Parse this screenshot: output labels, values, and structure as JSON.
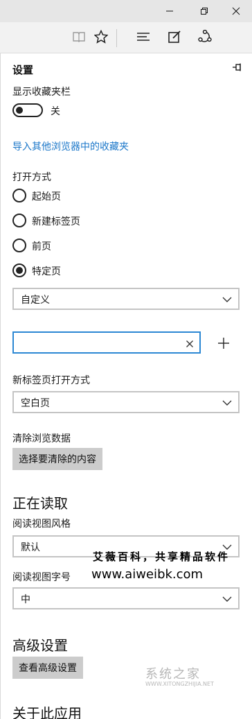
{
  "window_controls": {
    "minimize_icon": "minimize-icon",
    "maximize_icon": "restore-icon",
    "close_icon": "close-icon"
  },
  "toolbar": {
    "icons": [
      "reading-view-icon",
      "favorite-star-icon",
      "hub-icon",
      "web-note-icon",
      "share-icon"
    ]
  },
  "panel": {
    "title": "设置",
    "pin_icon": "pin-icon"
  },
  "favorites_bar": {
    "label": "显示收藏夹栏",
    "toggle_state": "关"
  },
  "import_link": "导入其他浏览器中的收藏夹",
  "open_with": {
    "label": "打开方式",
    "options": [
      "起始页",
      "新建标签页",
      "前页",
      "特定页"
    ],
    "selected": "特定页",
    "dropdown_value": "自定义",
    "url_input": {
      "value": "",
      "placeholder": ""
    }
  },
  "new_tab": {
    "label": "新标签页打开方式",
    "value": "空白页"
  },
  "clear_data": {
    "label": "清除浏览数据",
    "button": "选择要清除的内容"
  },
  "reading": {
    "section_title": "正在读取",
    "style_label": "阅读视图风格",
    "style_value": "默认",
    "font_label": "阅读视图字号",
    "font_value": "中"
  },
  "advanced": {
    "section_title": "高级设置",
    "button": "查看高级设置"
  },
  "about": {
    "section_title": "关于此应用"
  },
  "watermarks": {
    "line1": "艾薇百科，共享精品软件",
    "line2": "www.aiweibk.com",
    "line3": "系统之家",
    "line3_small": "WWW.XITONGZHIJIA.NET"
  },
  "colors": {
    "accent": "#2b87d3",
    "link": "#1b77c9",
    "button_bg": "#cccccc",
    "titlebar_bg": "#e6e6e6",
    "toolbar_bg": "#f2f2f2"
  }
}
